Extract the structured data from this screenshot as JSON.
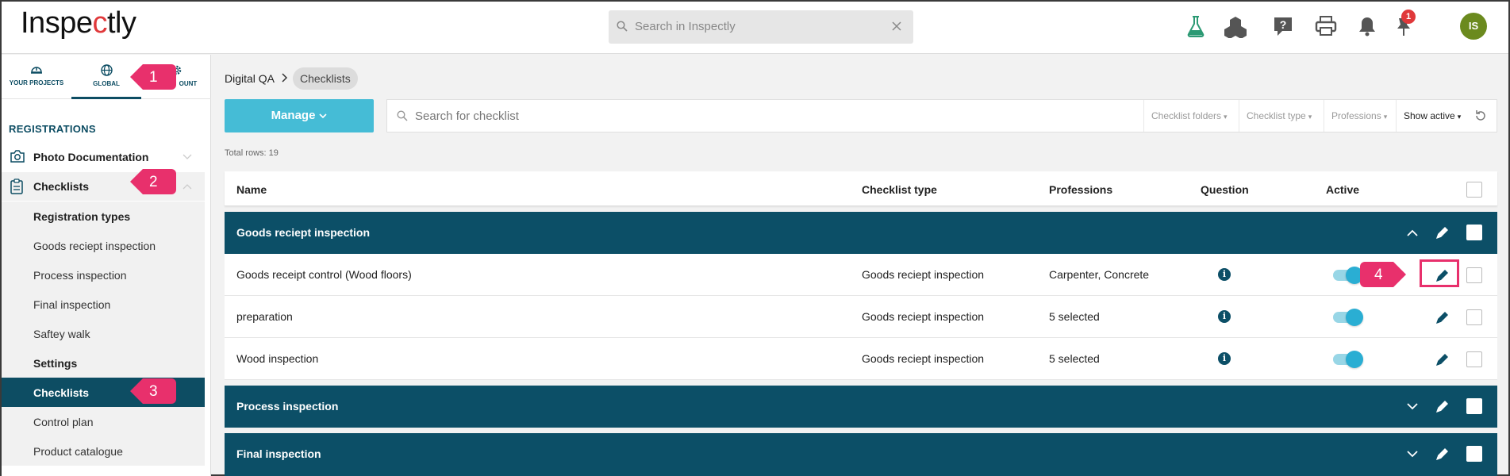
{
  "app": {
    "logo_text": "Inspectly"
  },
  "header": {
    "search_placeholder": "Search in Inspectly",
    "notification_count": "1",
    "avatar_initials": "IS",
    "icons": [
      "flask-icon",
      "cubes-icon",
      "help-icon",
      "printer-icon",
      "bell-icon",
      "pin-icon"
    ]
  },
  "sidebar": {
    "tabs": [
      {
        "label": "YOUR PROJECTS",
        "icon": "helmet-icon"
      },
      {
        "label": "GLOBAL",
        "icon": "globe-icon",
        "active": true
      },
      {
        "label": "OUNT",
        "icon": "gear-icon"
      }
    ],
    "section_title": "REGISTRATIONS",
    "items": [
      {
        "label": "Photo Documentation",
        "icon": "camera-icon"
      },
      {
        "label": "Checklists",
        "icon": "clipboard-icon"
      }
    ],
    "subitems": [
      {
        "label": "Registration types",
        "heading": true
      },
      {
        "label": "Goods reciept inspection"
      },
      {
        "label": "Process inspection"
      },
      {
        "label": "Final inspection"
      },
      {
        "label": "Saftey walk"
      },
      {
        "label": "Settings",
        "heading": true
      },
      {
        "label": "Checklists",
        "active": true
      },
      {
        "label": "Control plan"
      },
      {
        "label": "Product catalogue"
      }
    ]
  },
  "breadcrumb": {
    "parent": "Digital QA",
    "current": "Checklists"
  },
  "toolbar": {
    "manage_label": "Manage",
    "search_placeholder": "Search for checklist",
    "filters": [
      "Checklist folders",
      "Checklist type",
      "Professions",
      "Show active"
    ]
  },
  "table": {
    "total_rows": "Total rows: 19",
    "columns": [
      "Name",
      "Checklist type",
      "Professions",
      "Question",
      "Active"
    ],
    "groups": [
      {
        "title": "Goods reciept inspection",
        "expanded": true,
        "rows": [
          {
            "name": "Goods receipt control (Wood floors)",
            "type": "Goods reciept inspection",
            "professions": "Carpenter, Concrete",
            "active": true
          },
          {
            "name": "preparation",
            "type": "Goods reciept inspection",
            "professions": "5 selected",
            "active": true
          },
          {
            "name": "Wood inspection",
            "type": "Goods reciept inspection",
            "professions": "5 selected",
            "active": true
          }
        ]
      },
      {
        "title": "Process inspection",
        "expanded": false,
        "rows": []
      },
      {
        "title": "Final inspection",
        "expanded": false,
        "rows": []
      }
    ]
  },
  "annotations": {
    "callouts": [
      "1",
      "2",
      "3",
      "4"
    ],
    "color": "#e8306c"
  },
  "colors": {
    "primary": "#0c4f67",
    "accent": "#45bcd6",
    "toggle": "#2aaed3",
    "logo_accent": "#e0383a"
  }
}
